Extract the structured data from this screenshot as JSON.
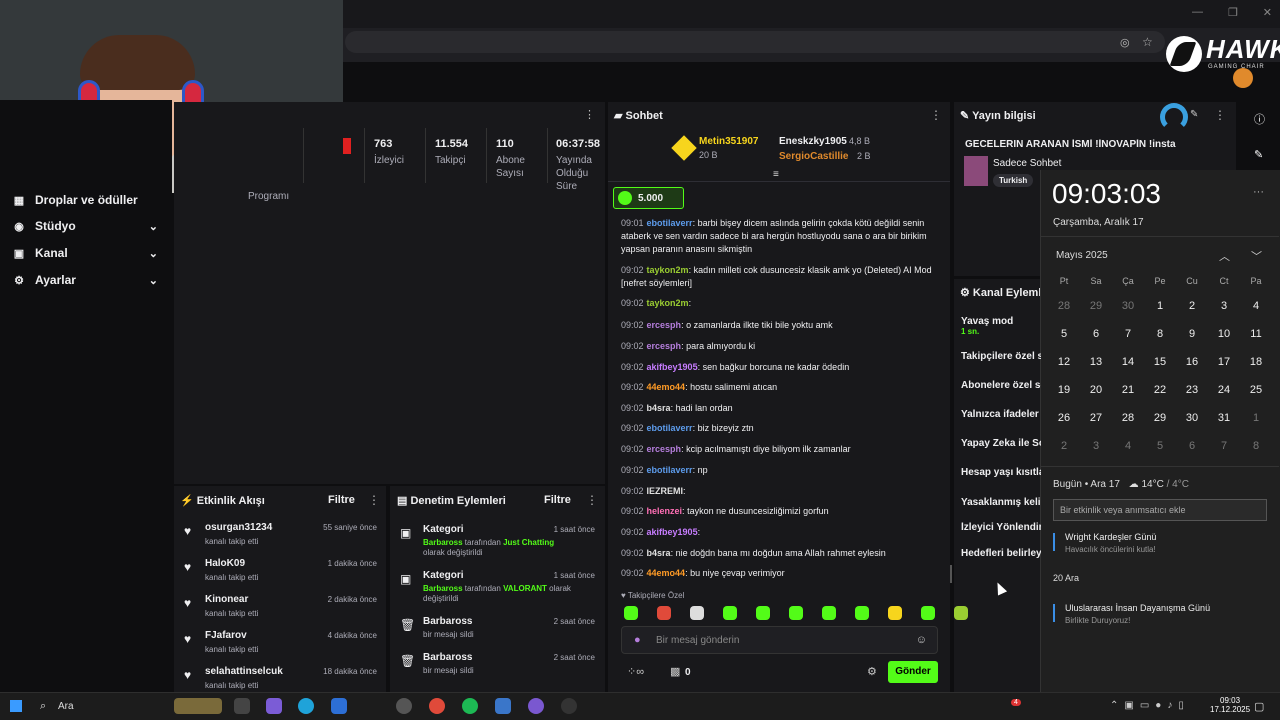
{
  "browser": {
    "title_controls": [
      "—",
      "❐",
      "✕"
    ]
  },
  "sidebar": {
    "items": [
      {
        "label": "Droplar ve ödüller",
        "icon": "gift-icon"
      },
      {
        "label": "Stüdyo",
        "icon": "studio-icon"
      },
      {
        "label": "Kanal",
        "icon": "channel-icon"
      },
      {
        "label": "Ayarlar",
        "icon": "gear-icon"
      }
    ]
  },
  "stats": {
    "program": "Programı",
    "items": [
      {
        "value": "763",
        "label": "İzleyici"
      },
      {
        "value": "11.554",
        "label": "Takipçi"
      },
      {
        "value": "110",
        "label": "Abone Sayısı"
      },
      {
        "value": "06:37:58",
        "label": "Yayında Olduğu Süre"
      }
    ]
  },
  "chat": {
    "title": "Sohbet",
    "leaders": [
      {
        "name": "Metin351907",
        "amount": "20 B"
      },
      {
        "name": "Eneskzky1905",
        "amount": "4,8 B"
      },
      {
        "name": "SergioCastillie",
        "amount": "2 B"
      }
    ],
    "points_badge": "5.000",
    "messages": [
      {
        "time": "09:01",
        "user": "ebotilaverr",
        "color": "#5d9cec",
        "text": "barbi bişey dicem aslında gelirin çokda kötü değildi senin ataberk ve sen vardın sadece bi ara hergün hostluyodu sana o ara bir birikim yapsan paranın anasını sikmiştin"
      },
      {
        "time": "09:02",
        "user": "taykon2m",
        "color": "#9acd32",
        "text": "kadın milleti cok dusuncesiz klasik amk yo (Deleted) AI Mod [nefret söylemleri]"
      },
      {
        "time": "09:02",
        "user": "taykon2m",
        "color": "#9acd32",
        "text": ""
      },
      {
        "time": "09:02",
        "user": "ercesph",
        "color": "#b57edc",
        "text": "o zamanlarda ilkte tiki bile yoktu amk"
      },
      {
        "time": "09:02",
        "user": "ercesph",
        "color": "#b57edc",
        "text": "para almıyordu ki"
      },
      {
        "time": "09:02",
        "user": "akifbey1905",
        "color": "#c77dff",
        "text": "sen bağkur borcuna ne kadar ödedin"
      },
      {
        "time": "09:02",
        "user": "44emo44",
        "color": "#ff9b26",
        "text": "hostu salimemi atıcan"
      },
      {
        "time": "09:02",
        "user": "b4sra",
        "color": "#e0e0e0",
        "text": "hadi lan ordan"
      },
      {
        "time": "09:02",
        "user": "ebotilaverr",
        "color": "#5d9cec",
        "text": "biz bizeyiz ztn"
      },
      {
        "time": "09:02",
        "user": "ercesph",
        "color": "#b57edc",
        "text": "kcip acılmamıştı diye biliyom ilk zamanlar"
      },
      {
        "time": "09:02",
        "user": "ebotilaverr",
        "color": "#5d9cec",
        "text": "np"
      },
      {
        "time": "09:02",
        "user": "IEZREMI",
        "color": "#e0e0e0",
        "text": ""
      },
      {
        "time": "09:02",
        "user": "helenzei",
        "color": "#ff6fb5",
        "text": "taykon ne dusuncesizliğimizi gorfun"
      },
      {
        "time": "09:02",
        "user": "akifbey1905",
        "color": "#c77dff",
        "text": ""
      },
      {
        "time": "09:02",
        "user": "b4sra",
        "color": "#e0e0e0",
        "text": "nie doğdn bana mı doğdun ama Allah rahmet eylesin"
      },
      {
        "time": "09:02",
        "user": "44emo44",
        "color": "#ff9b26",
        "text": "bu niye çevap verimiyor"
      }
    ],
    "followers_only": "Takipçilere Özel",
    "input_placeholder": "Bir mesaj gönderin",
    "send_label": "Gönder",
    "points_count": "0"
  },
  "stream_info": {
    "title": "Yayın bilgisi",
    "stream_title": "GECELERIN ARANAN İSMİ !İNOVAPİN !insta",
    "category": "Sadece Sohbet",
    "tag": "Turkish"
  },
  "channel_actions": {
    "title": "Kanal Eylemleri",
    "items": [
      {
        "label": "Yavaş mod",
        "sub": "1 sn."
      },
      {
        "label": "Takipçilere özel sohbet",
        "sub": ""
      },
      {
        "label": "Abonelere özel sohbet",
        "sub": ""
      },
      {
        "label": "Yalnızca ifadeler",
        "sub": ""
      },
      {
        "label": "Yapay Zeka ile Sohbet",
        "sub": ""
      },
      {
        "label": "Hesap yaşı kısıtlaması",
        "sub": ""
      },
      {
        "label": "Yasaklanmış kelimeler",
        "sub": ""
      },
      {
        "label": "İzleyici Yönlendirme",
        "sub": ""
      },
      {
        "label": "Hedefleri belirleyin",
        "sub": ""
      }
    ]
  },
  "activity": {
    "title": "Etkinlik Akışı",
    "filter": "Filtre",
    "items": [
      {
        "user": "osurgan31234",
        "action": "kanalı takip etti",
        "time": "55 saniye önce"
      },
      {
        "user": "HaloK09",
        "action": "kanalı takip etti",
        "time": "1 dakika önce"
      },
      {
        "user": "Kinonear",
        "action": "kanalı takip etti",
        "time": "2 dakika önce"
      },
      {
        "user": "FJafarov",
        "action": "kanalı takip etti",
        "time": "4 dakika önce"
      },
      {
        "user": "selahattinselcuk",
        "action": "kanalı takip etti",
        "time": "18 dakika önce"
      }
    ]
  },
  "moderation": {
    "title": "Denetim Eylemleri",
    "filter": "Filtre",
    "items": [
      {
        "title": "Kategori",
        "line1": "Barbaross",
        "mid": " tarafından ",
        "hl": "Just Chatting",
        "rest": " olarak değiştirildi",
        "time": "1 saat önce"
      },
      {
        "title": "Kategori",
        "line1": "Barbaross",
        "mid": " tarafından ",
        "hl": "VALORANT",
        "rest": " olarak değiştirildi",
        "time": "1 saat önce"
      },
      {
        "title": "Barbaross",
        "line1": "",
        "mid": "",
        "hl": "",
        "rest": "bir mesajı sildi",
        "time": "2 saat önce"
      },
      {
        "title": "Barbaross",
        "line1": "",
        "mid": "",
        "hl": "",
        "rest": "bir mesajı sildi",
        "time": "2 saat önce"
      }
    ]
  },
  "calendar": {
    "clock": "09:03:03",
    "date": "Çarşamba, Aralık 17",
    "month": "Mayıs 2025",
    "weekdays": [
      "Pt",
      "Sa",
      "Ça",
      "Pe",
      "Cu",
      "Ct",
      "Pa"
    ],
    "weeks": [
      [
        "28",
        "29",
        "30",
        "1",
        "2",
        "3",
        "4"
      ],
      [
        "5",
        "6",
        "7",
        "8",
        "9",
        "10",
        "11"
      ],
      [
        "12",
        "13",
        "14",
        "15",
        "16",
        "17",
        "18"
      ],
      [
        "19",
        "20",
        "21",
        "22",
        "23",
        "24",
        "25"
      ],
      [
        "26",
        "27",
        "28",
        "29",
        "30",
        "31",
        "1"
      ],
      [
        "2",
        "3",
        "4",
        "5",
        "6",
        "7",
        "8"
      ]
    ],
    "today_line": "Bugün • Ara 17",
    "weather": "14°C",
    "weather_low": "/ 4°C",
    "event_placeholder": "Bir etkinlik veya anımsatıcı ekle",
    "events": [
      {
        "title": "Wright Kardeşler Günü",
        "sub": "Havacılık öncülerini kutla!"
      },
      {
        "title": "Uluslararası İnsan Dayanışma Günü",
        "sub": "Birlikte Duruyoruz!"
      }
    ],
    "next_day": "20 Ara"
  },
  "brand": {
    "name": "HAWK",
    "sub": "GAMING CHAIR"
  },
  "taskbar": {
    "search": "Ara",
    "time": "09:03",
    "date": "17.12.2025",
    "badge": "4"
  }
}
